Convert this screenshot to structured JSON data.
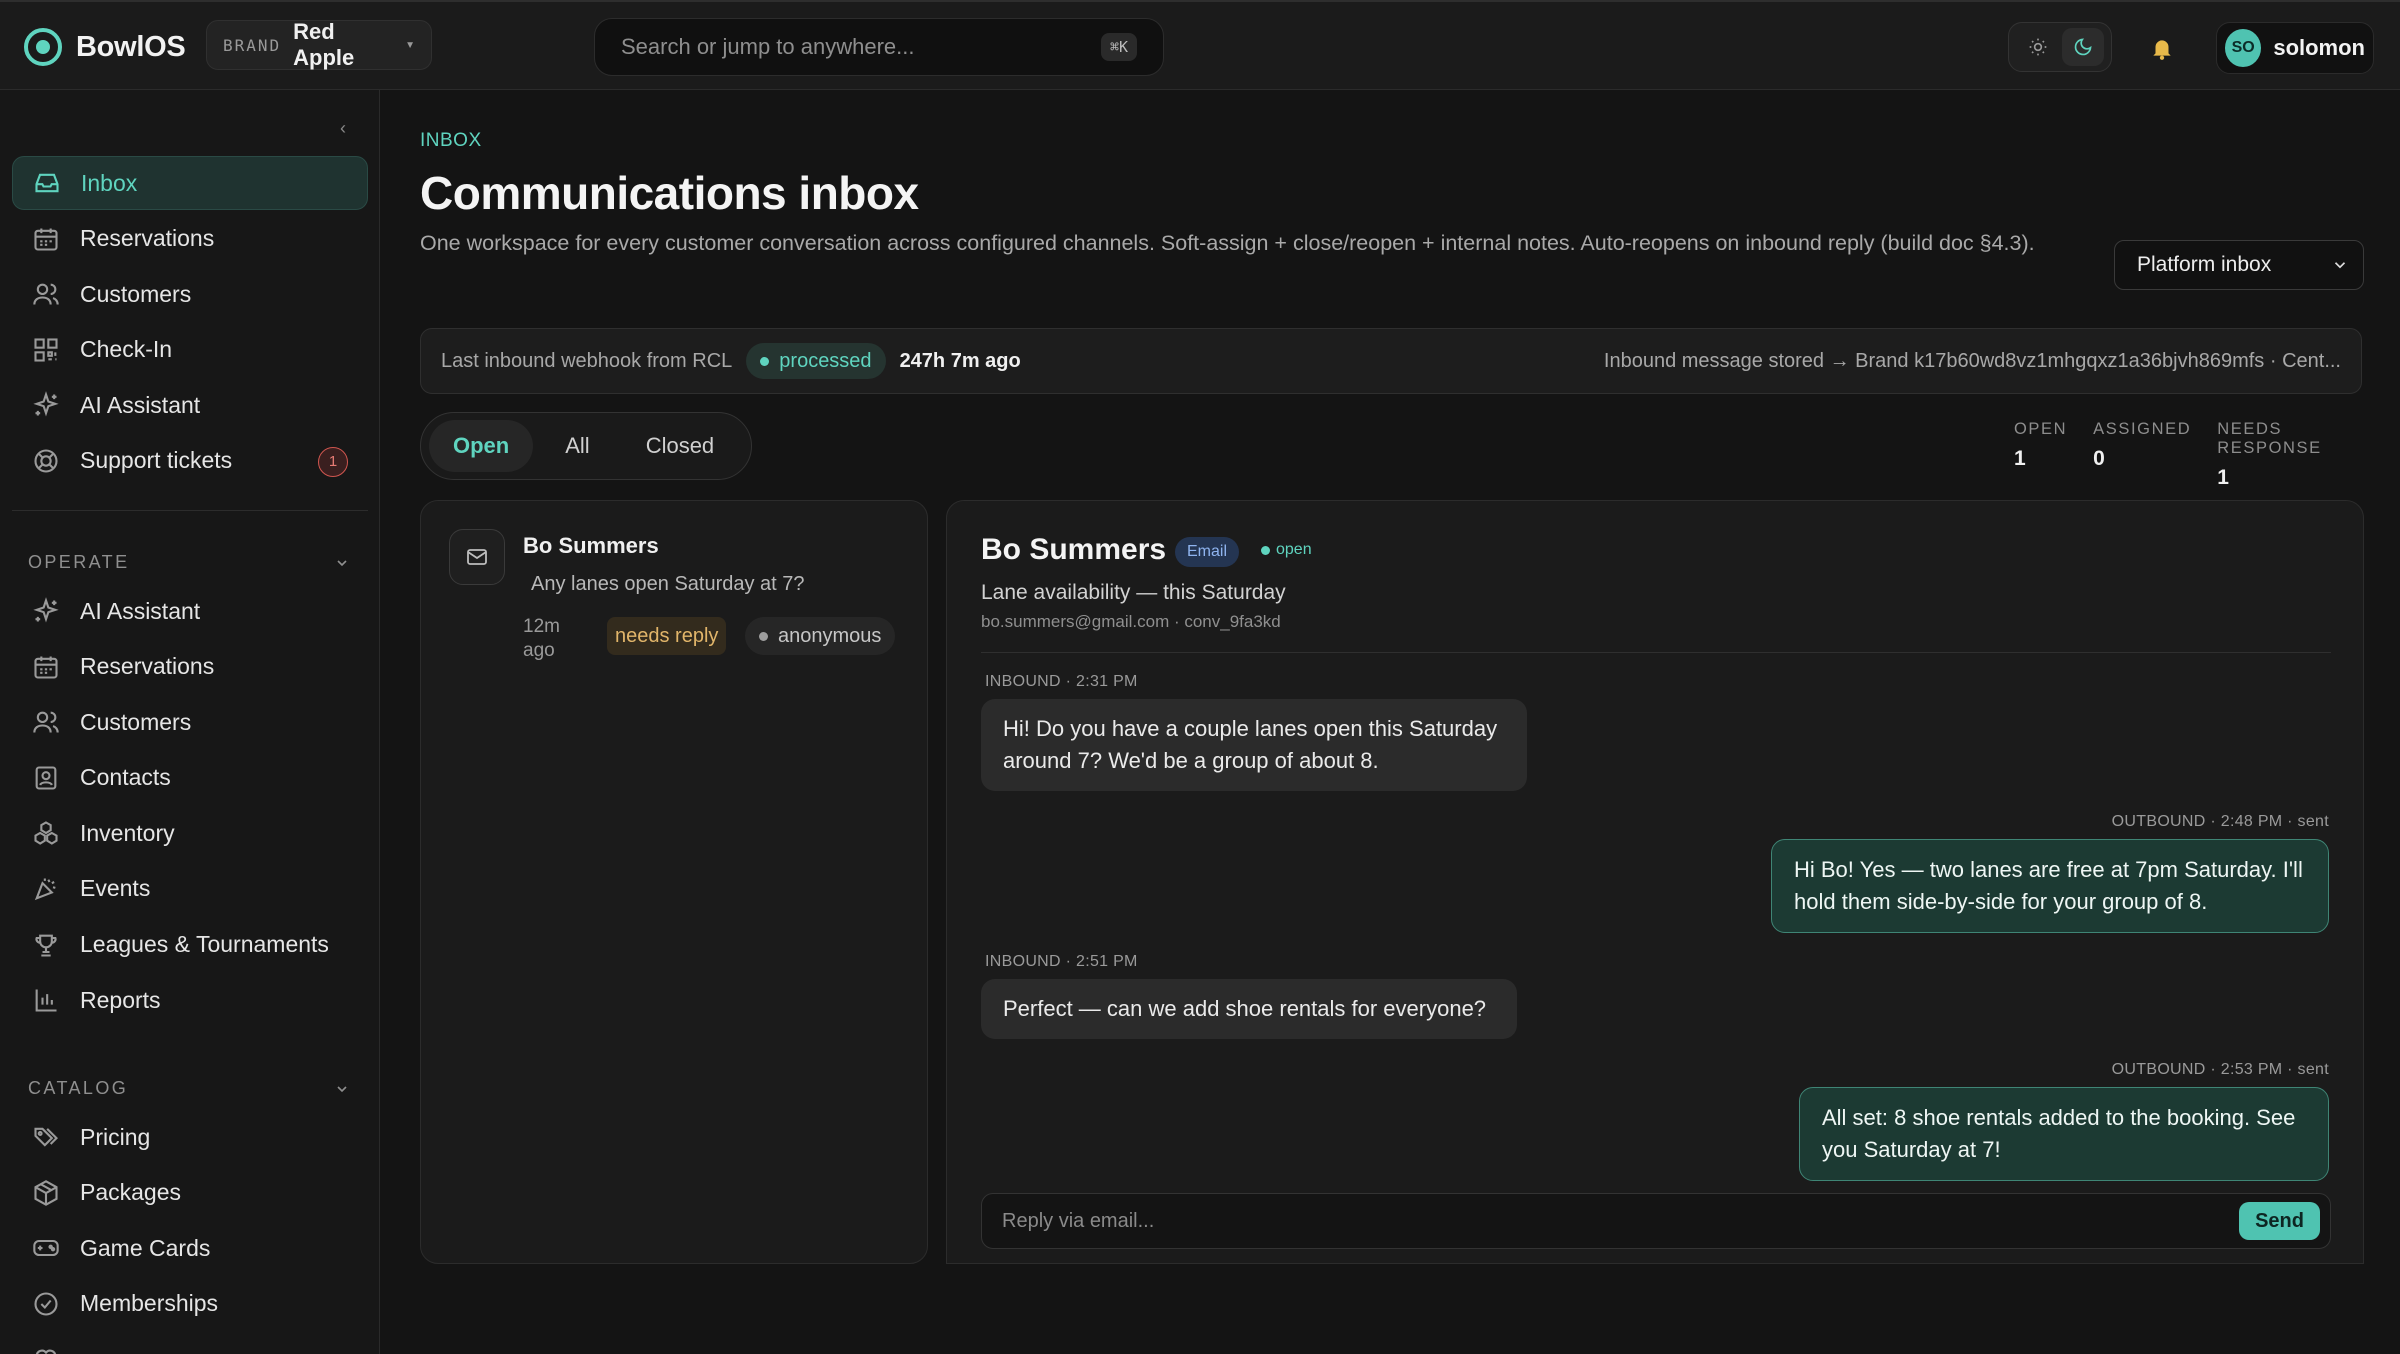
{
  "app": {
    "name": "BowlOS",
    "brand_tag": "BRAND",
    "brand_name": "Red Apple",
    "accent": "#5fd4bf"
  },
  "search": {
    "placeholder": "Search or jump to anywhere...",
    "shortcut": "⌘K"
  },
  "user": {
    "initials": "SO",
    "name": "solomon"
  },
  "sidebar": {
    "primary": [
      {
        "label": "Inbox",
        "icon": "inbox-icon",
        "active": true
      },
      {
        "label": "Reservations",
        "icon": "calendar-icon"
      },
      {
        "label": "Customers",
        "icon": "users-icon"
      },
      {
        "label": "Check-In",
        "icon": "qr-icon"
      },
      {
        "label": "AI Assistant",
        "icon": "sparkle-icon"
      },
      {
        "label": "Support tickets",
        "icon": "lifebuoy-icon",
        "badge": "1"
      }
    ],
    "operate_label": "OPERATE",
    "operate": [
      {
        "label": "AI Assistant",
        "icon": "sparkle-icon"
      },
      {
        "label": "Reservations",
        "icon": "calendar-icon"
      },
      {
        "label": "Customers",
        "icon": "users-icon"
      },
      {
        "label": "Contacts",
        "icon": "contact-card-icon"
      },
      {
        "label": "Inventory",
        "icon": "boxes-icon"
      },
      {
        "label": "Events",
        "icon": "party-popper-icon"
      },
      {
        "label": "Leagues & Tournaments",
        "icon": "trophy-icon"
      },
      {
        "label": "Reports",
        "icon": "bar-chart-icon"
      }
    ],
    "catalog_label": "CATALOG",
    "catalog": [
      {
        "label": "Pricing",
        "icon": "tags-icon"
      },
      {
        "label": "Packages",
        "icon": "package-icon"
      },
      {
        "label": "Game Cards",
        "icon": "gamepad-icon"
      },
      {
        "label": "Memberships",
        "icon": "badge-check-icon"
      }
    ]
  },
  "page": {
    "eyebrow": "INBOX",
    "title": "Communications inbox",
    "description": "One workspace for every customer conversation across configured channels. Soft-assign + close/reopen + internal notes. Auto-reopens on inbound reply (build doc §4.3).",
    "inbox_select": "Platform inbox"
  },
  "webhook": {
    "label": "Last inbound webhook from RCL",
    "status": "processed",
    "age": "247h 7m ago",
    "detail": "Inbound message stored → Brand k17b60wd8vz1mhgqxz1a36bjvh869mfs · Cent..."
  },
  "tabs": [
    "Open",
    "All",
    "Closed"
  ],
  "active_tab": "Open",
  "stats": [
    {
      "label": "OPEN",
      "value": "1"
    },
    {
      "label": "ASSIGNED",
      "value": "0"
    },
    {
      "label": "NEEDS RESPONSE",
      "value": "1"
    }
  ],
  "conversation_list": [
    {
      "name": "Bo Summers",
      "preview": "Any lanes open Saturday at 7?",
      "time": "12m ago",
      "tag": "needs reply",
      "identity": "anonymous"
    }
  ],
  "thread": {
    "name": "Bo Summers",
    "channel": "Email",
    "state": "open",
    "subject": "Lane availability — this Saturday",
    "meta": "bo.summers@gmail.com · conv_9fa3kd",
    "messages": [
      {
        "direction": "in",
        "label": "INBOUND · 2:31 PM",
        "text": "Hi! Do you have a couple lanes open this Saturday around 7? We'd be a group of about 8."
      },
      {
        "direction": "out",
        "label": "OUTBOUND · 2:48 PM · sent",
        "text": "Hi Bo! Yes — two lanes are free at 7pm Saturday. I'll hold them side-by-side for your group of 8."
      },
      {
        "direction": "in",
        "label": "INBOUND · 2:51 PM",
        "text": "Perfect — can we add shoe rentals for everyone?"
      },
      {
        "direction": "out",
        "label": "OUTBOUND · 2:53 PM · sent",
        "text": "All set: 8 shoe rentals added to the booking. See you Saturday at 7!"
      }
    ],
    "reply_placeholder": "Reply via email...",
    "send_label": "Send"
  }
}
